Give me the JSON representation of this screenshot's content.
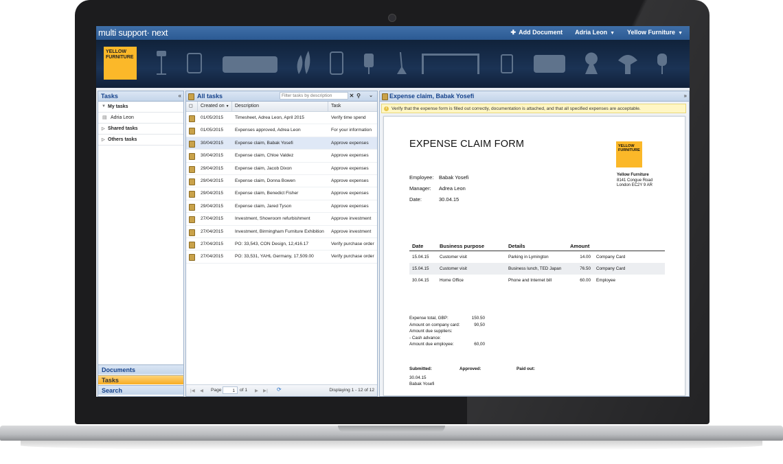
{
  "app": {
    "brand": "multi support· next",
    "top_nav": {
      "add_document": "Add Document",
      "user": "Adria Leon",
      "company": "Yellow Furniture"
    },
    "logo_text": "YELLOW FURNITURE"
  },
  "left_panel": {
    "title": "Tasks",
    "tree": {
      "my_tasks": "My tasks",
      "user": "Adria Leon",
      "shared": "Shared tasks",
      "others": "Others tasks"
    },
    "nav": [
      "Documents",
      "Tasks",
      "Search"
    ]
  },
  "mid_panel": {
    "title": "All tasks",
    "filter_placeholder": "Filter tasks by description",
    "columns": {
      "created": "Created on",
      "description": "Description",
      "task": "Task"
    },
    "rows": [
      {
        "date": "01/05/2015",
        "desc": "Timesheet, Adrea Leon, April 2015",
        "task": "Verify time spend"
      },
      {
        "date": "01/05/2015",
        "desc": "Expenses approved, Adrea Leon",
        "task": "For your information"
      },
      {
        "date": "30/04/2015",
        "desc": "Expense claim, Babak Yosefi",
        "task": "Approve expenses"
      },
      {
        "date": "30/04/2015",
        "desc": "Expense claim, Chloe Valdez",
        "task": "Approve expenses"
      },
      {
        "date": "29/04/2015",
        "desc": "Expense claim, Jacob Dixon",
        "task": "Approve expenses"
      },
      {
        "date": "29/04/2015",
        "desc": "Expense claim, Donna Bowen",
        "task": "Approve expenses"
      },
      {
        "date": "29/04/2015",
        "desc": "Expense claim, Benedict Fisher",
        "task": "Approve expenses"
      },
      {
        "date": "29/04/2015",
        "desc": "Expense claim, Jared Tyson",
        "task": "Approve expenses"
      },
      {
        "date": "27/04/2015",
        "desc": "Investment, Showroom refurbishment",
        "task": "Approve investment"
      },
      {
        "date": "27/04/2015",
        "desc": "Investment, Birmingham Furniture Exhibition",
        "task": "Approve investment"
      },
      {
        "date": "27/04/2015",
        "desc": "PO: 33,543, CON Design, 12,416.17",
        "task": "Verify purchase order"
      },
      {
        "date": "27/04/2015",
        "desc": "PO: 33,531, YAHL Germany, 17,509.00",
        "task": "Verify purchase order"
      }
    ],
    "pager": {
      "page_label": "Page",
      "page": "1",
      "of": "of 1",
      "display": "Displaying 1 - 12 of 12"
    }
  },
  "right_panel": {
    "title": "Expense claim, Babak Yosefi",
    "notice": "Verify that the expense form is filled out correctly, documentation is attached, and that all specified expenses are acceptable.",
    "doc": {
      "title": "EXPENSE CLAIM FORM",
      "logo_text": "YELLOW FURNITURE",
      "company": "Yellow Furniture",
      "addr1": "8141 Congue Road",
      "addr2": "London EC2Y 9 AR",
      "employee_label": "Employee:",
      "employee": "Babak Yosefi",
      "manager_label": "Manager:",
      "manager": "Adrea Leon",
      "date_label": "Date:",
      "date": "30.04.15",
      "table_headers": [
        "Date",
        "Business purpose",
        "Details",
        "Amount",
        ""
      ],
      "table_rows": [
        [
          "15.04.15",
          "Customer visit",
          "Parking in Lymington",
          "14.00",
          "Company Card"
        ],
        [
          "15.04.15",
          "Customer visit",
          "Business lunch, TED Japan",
          "76.50",
          "Company Card"
        ],
        [
          "30.04.15",
          "Home Office",
          "Phone and Internet bill",
          "60.00",
          "Employee"
        ]
      ],
      "totals": [
        [
          "Expense total, GBP:",
          "150.50"
        ],
        [
          "Amount on company card:",
          "90,50"
        ],
        [
          "Amount due suppliers:",
          ""
        ],
        [
          "- Cash advance:",
          ""
        ],
        [
          "Amount due employee:",
          "60,00"
        ]
      ],
      "submitted_label": "Submitted:",
      "approved_label": "Approved:",
      "paid_label": "Paid out:",
      "submitted_date": "30.04.15",
      "submitted_by": "Babak Yosefi"
    }
  }
}
